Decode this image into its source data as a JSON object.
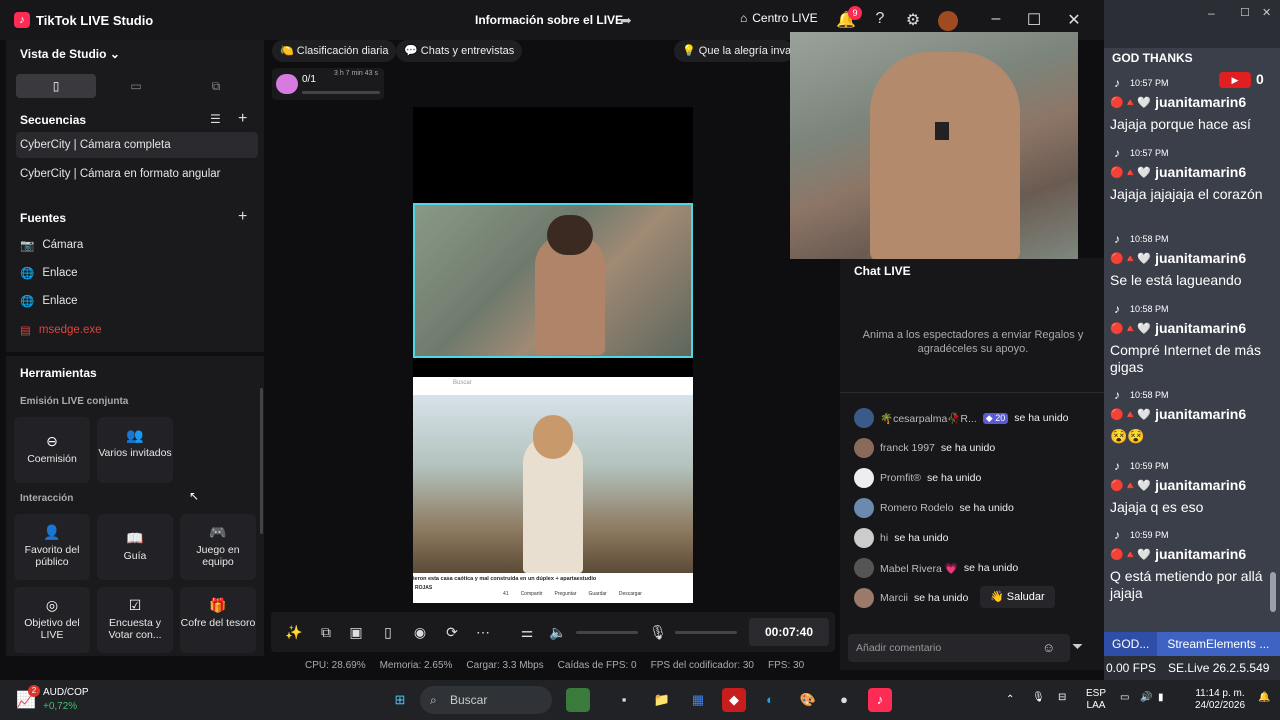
{
  "app": {
    "title": "TikTok LIVE Studio",
    "center_title": "Información sobre el LIVE",
    "home_label": "Centro LIVE",
    "notification_count": "9"
  },
  "studio": {
    "view_label": "Vista de Studio",
    "sequences_title": "Secuencias",
    "sequences": [
      "CyberCity | Cámara completa",
      "CyberCity | Cámara en formato angular"
    ],
    "sources_title": "Fuentes",
    "sources": [
      "Cámara",
      "Enlace",
      "Enlace",
      "msedge.exe"
    ]
  },
  "tools": {
    "title": "Herramientas",
    "joint_title": "Emisión LIVE conjunta",
    "joint": [
      "Coemisión",
      "Varios invitados"
    ],
    "interaction_title": "Interacción",
    "interaction": [
      "Favorito del público",
      "Guía",
      "Juego en equipo",
      "Objetivo del LIVE",
      "Encuesta y Votar con...",
      "Cofre del tesoro"
    ]
  },
  "chips": [
    "Clasificación diaria",
    "Chats y entrevistas",
    "Que la alegría invad"
  ],
  "goal": {
    "progress": "0/1",
    "time": "3 h 7 min 43 s",
    "fraction": 0.0
  },
  "canvas": {
    "browser_search": "Buscar",
    "caption": "ieron esta casa caótica y mal construida en un dúplex + apartaestudio",
    "channel": "ROJAS",
    "actions": [
      "41",
      "Compartir",
      "Preguntar",
      "Guardar",
      "Descargar"
    ]
  },
  "controls": {
    "timer": "00:07:40"
  },
  "stats": [
    "CPU: 28.69%",
    "Memoria: 2.65%",
    "Cargar: 3.3 Mbps",
    "Caídas de FPS: 0",
    "FPS del codificador: 30",
    "FPS: 30"
  ],
  "chat": {
    "title": "Chat LIVE",
    "hint": "Anima a los espectadores a enviar Regalos y agradéceles su apoyo.",
    "joined_label": "se ha unido",
    "joins": [
      {
        "name": "🌴cesarpalma🥀R...",
        "level": "20"
      },
      {
        "name": "franck 1997"
      },
      {
        "name": "Promfit®"
      },
      {
        "name": "Romero Rodelo"
      },
      {
        "name": "hi"
      },
      {
        "name": "Mabel Rivera 💗"
      },
      {
        "name": "Marcii"
      }
    ],
    "greet": "Saludar",
    "comment_placeholder": "Añadir comentario"
  },
  "overlay": {
    "header": "GOD THANKS",
    "yt_count": "0",
    "user": "juanitamarin6",
    "entries": [
      {
        "time": "10:57 PM",
        "msg": "Jajaja porque hace así"
      },
      {
        "time": "10:57 PM",
        "msg": "Jajaja jajajaja el corazón"
      },
      {
        "time": "10:58 PM",
        "msg": "Se le está lagueando"
      },
      {
        "time": "10:58 PM",
        "msg": "Compré Internet de más gigas"
      },
      {
        "time": "10:58 PM",
        "msg": "😵😵"
      },
      {
        "time": "10:59 PM",
        "msg": "Jajaja q es eso"
      },
      {
        "time": "10:59 PM",
        "msg": "Q está metiendo por allá jajaja"
      }
    ],
    "tabs": [
      "GOD...",
      "StreamElements ..."
    ],
    "fps": "0.00 FPS",
    "version": "SE.Live 26.2.5.549"
  },
  "taskbar": {
    "ticker": "AUD/COP",
    "change": "+0,72%",
    "ticker_badge": "2",
    "search": "Buscar",
    "lang1": "ESP",
    "lang2": "LAA",
    "time": "11:14 p. m.",
    "date": "24/02/2026"
  }
}
